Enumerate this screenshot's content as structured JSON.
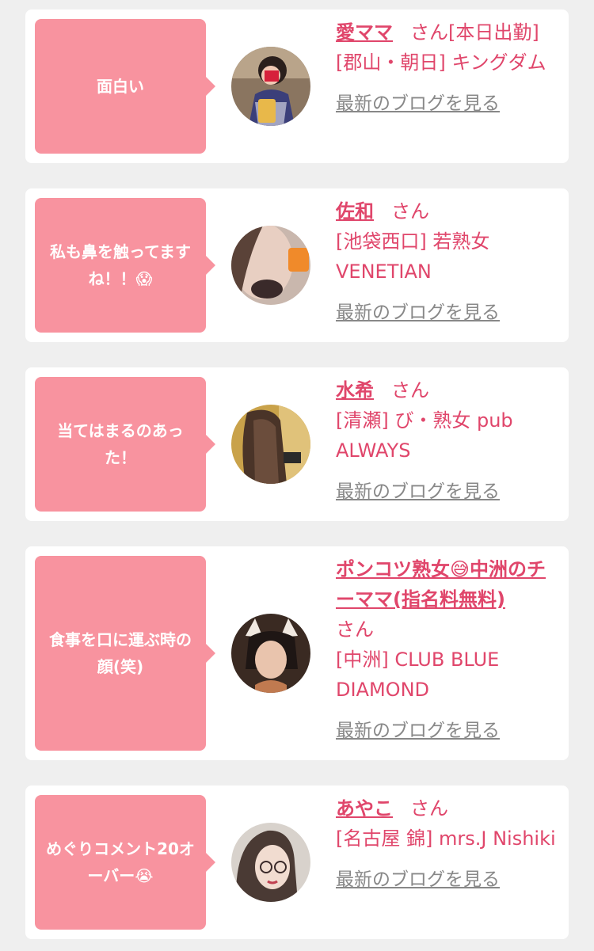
{
  "items": [
    {
      "comment": "面白い",
      "name": "愛ママ",
      "suffix": "さん[本日出勤]",
      "shop": "[郡山・朝日] キングダム",
      "blog_link": "最新のブログを見る",
      "avatar_icon": "woman-with-beer-avatar-icon"
    },
    {
      "comment": "私も鼻を触ってますね！！😱",
      "name": "佐和",
      "suffix": "さん",
      "shop": "[池袋西口] 若熟女 VENETIAN",
      "blog_link": "最新のブログを見る",
      "avatar_icon": "woman-closeup-avatar-icon"
    },
    {
      "comment": "当てはまるのあった！",
      "name": "水希",
      "suffix": "さん",
      "shop": "[清瀬] び・熟女 pub ALWAYS",
      "blog_link": "最新のブログを見る",
      "avatar_icon": "woman-long-hair-avatar-icon"
    },
    {
      "comment": "食事を口に運ぶ時の顔(笑)",
      "name": "ポンコツ熟女😅中洲のチーママ(指名料無料)",
      "suffix": "さん",
      "shop": "[中洲] CLUB BLUE DIAMOND",
      "blog_link": "最新のブログを見る",
      "avatar_icon": "woman-cat-ears-avatar-icon"
    },
    {
      "comment": "めぐりコメント20オーバー😭",
      "name": "あやこ",
      "suffix": "さん",
      "shop": "[名古屋 錦] mrs.J Nishiki",
      "blog_link": "最新のブログを見る",
      "avatar_icon": "woman-glasses-avatar-icon"
    }
  ],
  "colors": {
    "page_background": "#efefef",
    "card_background": "#ffffff",
    "bubble_pink": "#f8939f",
    "text_pink": "#e0466b",
    "link_gray": "#888888"
  }
}
